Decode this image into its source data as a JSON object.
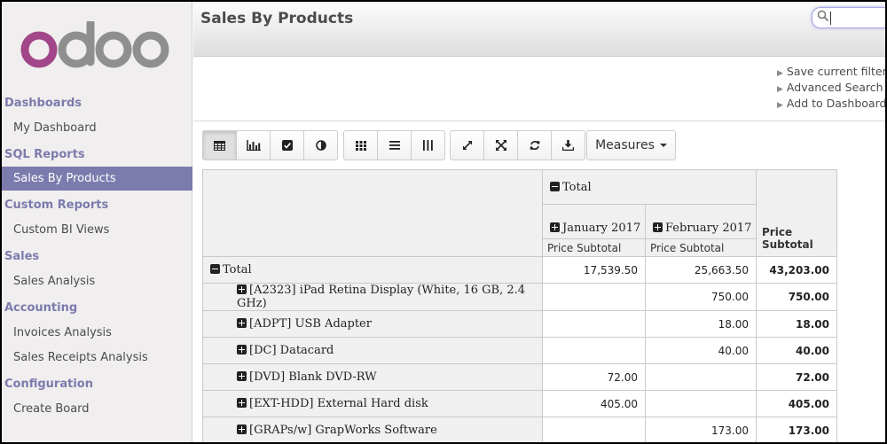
{
  "app": {
    "logo_text": "odoo",
    "page_title": "Sales By Products"
  },
  "search": {
    "placeholder": ""
  },
  "sidebar": {
    "sections": [
      {
        "title": "Dashboards",
        "items": [
          {
            "label": "My Dashboard",
            "active": false
          }
        ]
      },
      {
        "title": "SQL Reports",
        "items": [
          {
            "label": "Sales By Products",
            "active": true
          }
        ]
      },
      {
        "title": "Custom Reports",
        "items": [
          {
            "label": "Custom BI Views",
            "active": false
          }
        ]
      },
      {
        "title": "Sales",
        "items": [
          {
            "label": "Sales Analysis",
            "active": false
          }
        ]
      },
      {
        "title": "Accounting",
        "items": [
          {
            "label": "Invoices Analysis",
            "active": false
          },
          {
            "label": "Sales Receipts Analysis",
            "active": false
          }
        ]
      },
      {
        "title": "Configuration",
        "items": [
          {
            "label": "Create Board",
            "active": false
          }
        ]
      }
    ]
  },
  "filters": {
    "save_current_filter": "Save current filter",
    "advanced_search": "Advanced Search",
    "add_to_dashboard": "Add to Dashboard"
  },
  "toolbar": {
    "view_buttons": [
      "table-icon",
      "bar-chart-icon",
      "checkbox-icon",
      "pie-chart-icon"
    ],
    "layout_buttons": [
      "grid-icon",
      "list-icon",
      "columns-icon"
    ],
    "action_buttons": [
      "expand-icon",
      "fullscreen-icon",
      "refresh-icon",
      "download-icon"
    ],
    "measures_label": "Measures"
  },
  "pivot": {
    "col_total_label": "Total",
    "columns": [
      "January 2017",
      "February 2017"
    ],
    "measure_label": "Price Subtotal",
    "total_measure_label": "Price Subtotal",
    "total_row": {
      "label": "Total",
      "values": [
        "17,539.50",
        "25,663.50"
      ],
      "total": "43,203.00"
    },
    "rows": [
      {
        "label": "[A2323] iPad Retina Display (White, 16 GB, 2.4 GHz)",
        "values": [
          "",
          "750.00"
        ],
        "total": "750.00"
      },
      {
        "label": "[ADPT] USB Adapter",
        "values": [
          "",
          "18.00"
        ],
        "total": "18.00"
      },
      {
        "label": "[DC] Datacard",
        "values": [
          "",
          "40.00"
        ],
        "total": "40.00"
      },
      {
        "label": "[DVD] Blank DVD-RW",
        "values": [
          "72.00",
          ""
        ],
        "total": "72.00"
      },
      {
        "label": "[EXT-HDD] External Hard disk",
        "values": [
          "405.00",
          ""
        ],
        "total": "405.00"
      },
      {
        "label": "[GRAPs/w] GrapWorks Software",
        "values": [
          "",
          "173.00"
        ],
        "total": "173.00"
      }
    ]
  },
  "colors": {
    "accent": "#7c7bad",
    "logo": "#a24689",
    "logo_grey": "#8f8f8f"
  }
}
